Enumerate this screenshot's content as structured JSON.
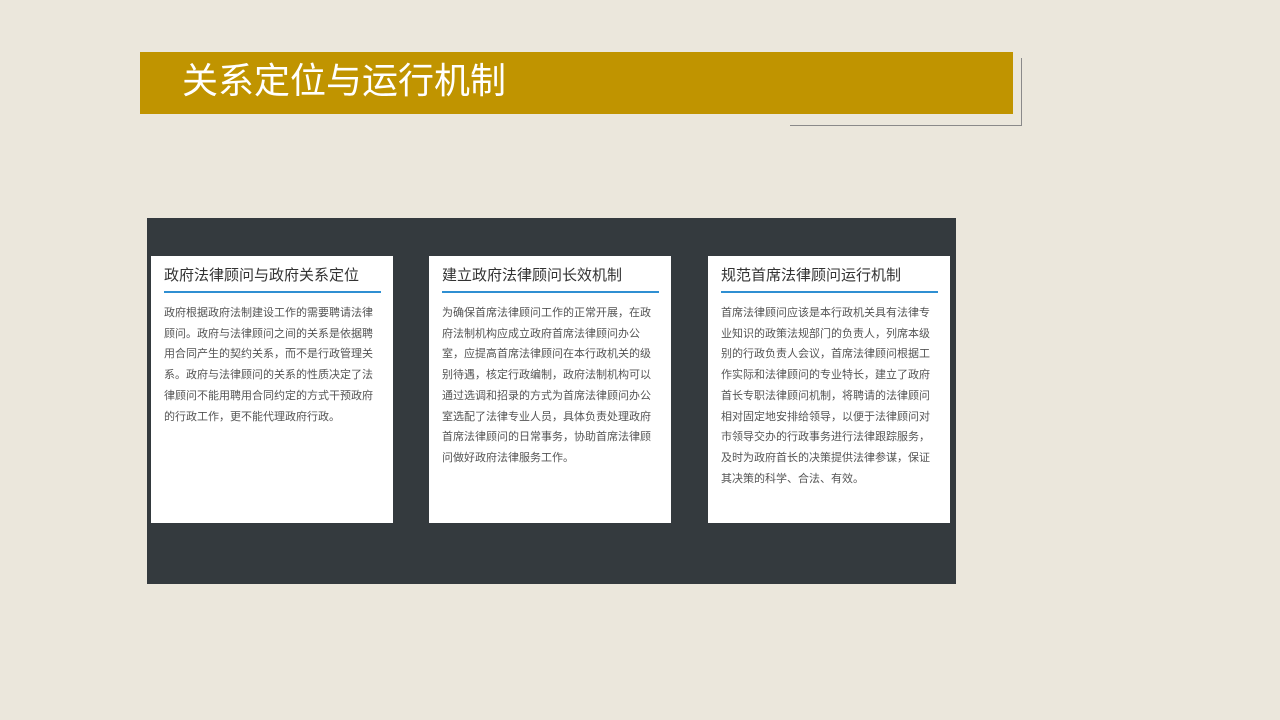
{
  "slide": {
    "title": "关系定位与运行机制"
  },
  "cards": [
    {
      "title": "政府法律顾问与政府关系定位",
      "body": "政府根据政府法制建设工作的需要聘请法律顾问。政府与法律顾问之间的关系是依据聘用合同产生的契约关系，而不是行政管理关系。政府与法律顾问的关系的性质决定了法律顾问不能用聘用合同约定的方式干预政府的行政工作，更不能代理政府行政。"
    },
    {
      "title": "建立政府法律顾问长效机制",
      "body": "为确保首席法律顾问工作的正常开展，在政府法制机构应成立政府首席法律顾问办公室，应提高首席法律顾问在本行政机关的级别待遇，核定行政编制，政府法制机构可以通过选调和招录的方式为首席法律顾问办公室选配了法律专业人员，具体负责处理政府首席法律顾问的日常事务，协助首席法律顾问做好政府法律服务工作。"
    },
    {
      "title": "规范首席法律顾问运行机制",
      "body": "首席法律顾问应该是本行政机关具有法律专业知识的政策法规部门的负责人，列席本级别的行政负责人会议，首席法律顾问根据工作实际和法律顾问的专业特长，建立了政府首长专职法律顾问机制，将聘请的法律顾问相对固定地安排给领导，以便于法律顾问对市领导交办的行政事务进行法律跟踪服务，及时为政府首长的决策提供法律参谋，保证其决策的科学、合法、有效。"
    }
  ],
  "colors": {
    "background": "#ebe7dc",
    "title_banner": "#c09400",
    "panel": "#343a3e",
    "card": "#ffffff",
    "card_rule": "#2f8fd2"
  }
}
